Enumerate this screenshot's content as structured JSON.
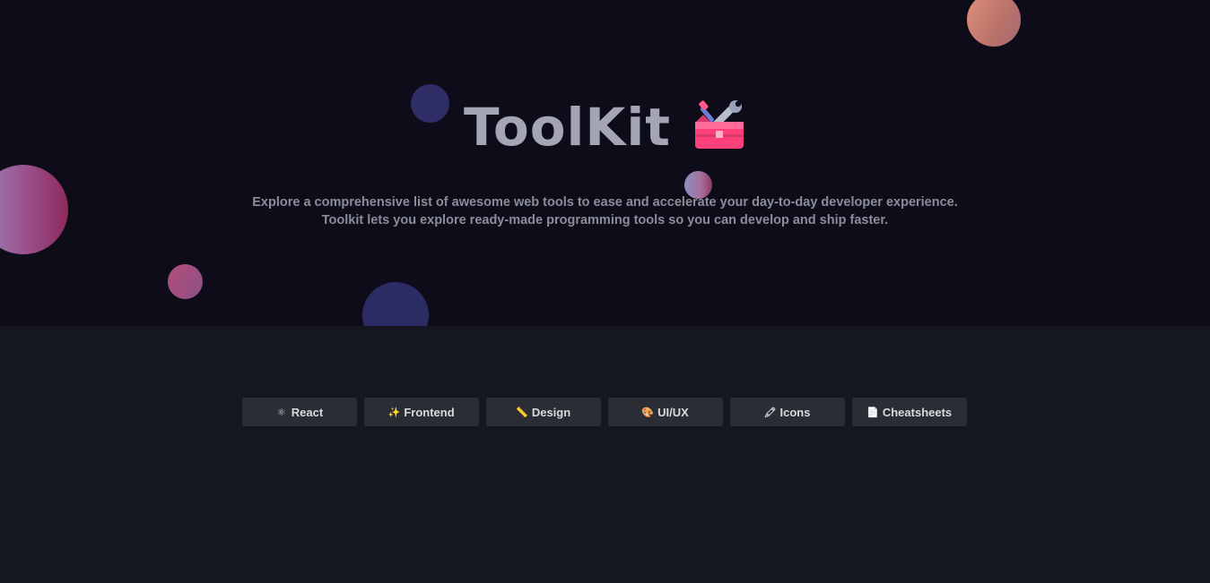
{
  "hero": {
    "title": "ToolKit",
    "title_icon": "toolbox-icon",
    "subtitle_line1": "Explore a comprehensive list of awesome web tools to ease and accelerate your day-to-day developer experience.",
    "subtitle_line2": "Toolkit lets you explore ready-made programming tools so you can develop and ship faster."
  },
  "tags": [
    {
      "label": "React",
      "icon": "react-atom-icon",
      "glyph": "⚛"
    },
    {
      "label": "Frontend",
      "icon": "sparkles-icon",
      "glyph": "✨"
    },
    {
      "label": "Design",
      "icon": "ruler-icon",
      "glyph": "📏"
    },
    {
      "label": "UI/UX",
      "icon": "palette-icon",
      "glyph": "🎨"
    },
    {
      "label": "Icons",
      "icon": "pen-icon",
      "glyph": "🖍"
    },
    {
      "label": "Cheatsheets",
      "icon": "page-icon",
      "glyph": "📄"
    }
  ],
  "colors": {
    "hero_bg": "#0e0c19",
    "body_bg": "#141620",
    "tag_bg": "#2a2d33",
    "title": "#a3a6b2"
  }
}
